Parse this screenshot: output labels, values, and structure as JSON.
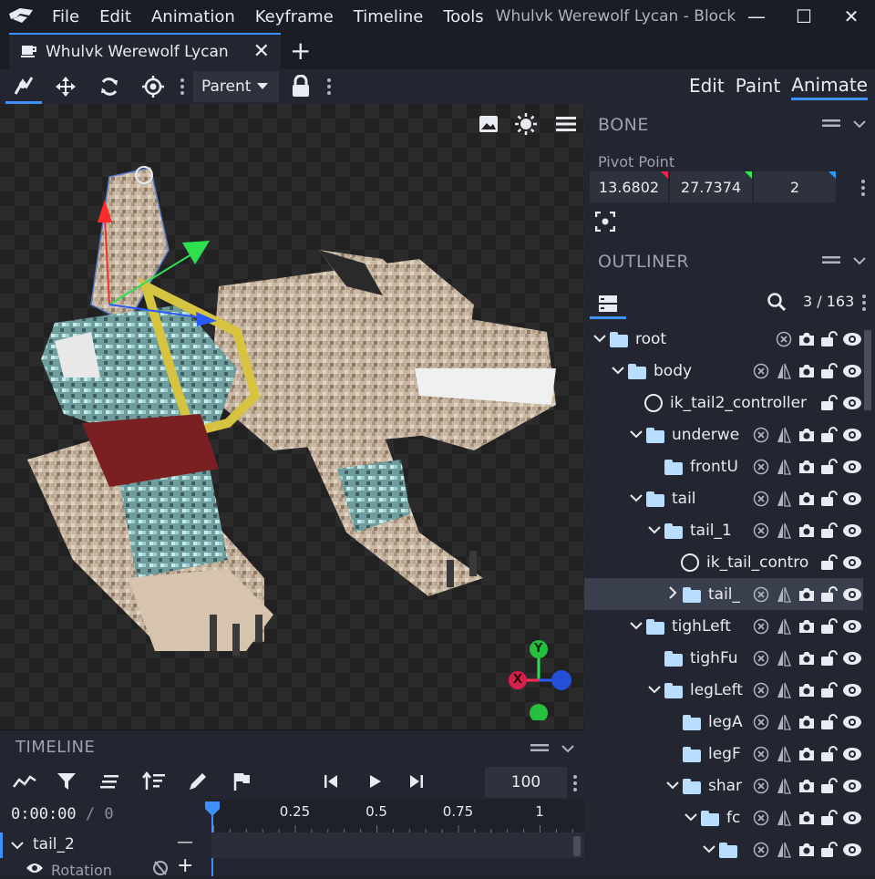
{
  "window": {
    "menu": [
      "File",
      "Edit",
      "Animation",
      "Keyframe",
      "Timeline",
      "Tools"
    ],
    "title": "Whulvk Werewolf Lycan - Block",
    "minimize": "—",
    "maximize": "☐",
    "close": "✕"
  },
  "tabs": [
    {
      "label": "Whulvk Werewolf Lycan",
      "close": "✕"
    }
  ],
  "tab_add": "+",
  "toolbar": {
    "parent_select": "Parent",
    "modes": [
      "Edit",
      "Paint",
      "Animate"
    ],
    "active_mode": "Animate"
  },
  "bone_panel": {
    "title": "BONE",
    "pivot_label": "Pivot Point",
    "pivot": [
      "13.6802",
      "27.7374",
      "2"
    ],
    "pivot_colors": [
      "#ff1f4f",
      "#2eea50",
      "#2b9bff"
    ]
  },
  "outliner": {
    "title": "OUTLINER",
    "count": "3 / 163",
    "items": [
      {
        "label": "root",
        "type": "folder",
        "depth": 0,
        "arrow": "down",
        "icons": [
          "x",
          "cam",
          "lock",
          "eye"
        ]
      },
      {
        "label": "body",
        "type": "folder",
        "depth": 1,
        "arrow": "down",
        "icons": [
          "x",
          "mirror",
          "cam",
          "lock",
          "eye"
        ]
      },
      {
        "label": "ik_tail2_controller",
        "type": "locator",
        "depth": 2,
        "arrow": "",
        "icons": [
          "lock",
          "eye"
        ]
      },
      {
        "label": "underwe",
        "type": "folder",
        "depth": 2,
        "arrow": "down",
        "icons": [
          "x",
          "mirror",
          "cam",
          "lock",
          "eye"
        ]
      },
      {
        "label": "frontU",
        "type": "folder",
        "depth": 3,
        "arrow": "",
        "icons": [
          "x",
          "mirror",
          "cam",
          "lock",
          "eye"
        ]
      },
      {
        "label": "tail",
        "type": "folder",
        "depth": 2,
        "arrow": "down",
        "icons": [
          "x",
          "mirror",
          "cam",
          "lock",
          "eye"
        ]
      },
      {
        "label": "tail_1",
        "type": "folder",
        "depth": 3,
        "arrow": "down",
        "icons": [
          "x",
          "mirror",
          "cam",
          "lock",
          "eye"
        ]
      },
      {
        "label": "ik_tail_contro",
        "type": "locator",
        "depth": 4,
        "arrow": "",
        "icons": [
          "lock",
          "eye"
        ]
      },
      {
        "label": "tail_",
        "type": "folder",
        "depth": 4,
        "arrow": "right",
        "selected": true,
        "icons": [
          "x",
          "mirror",
          "cam",
          "lock",
          "eye"
        ]
      },
      {
        "label": "tighLeft",
        "type": "folder",
        "depth": 2,
        "arrow": "down",
        "icons": [
          "x",
          "mirror",
          "cam",
          "lock",
          "eye"
        ]
      },
      {
        "label": "tighFu",
        "type": "folder",
        "depth": 3,
        "arrow": "",
        "icons": [
          "x",
          "mirror",
          "cam",
          "lock",
          "eye"
        ]
      },
      {
        "label": "legLeft",
        "type": "folder",
        "depth": 3,
        "arrow": "down",
        "icons": [
          "x",
          "mirror",
          "cam",
          "lock",
          "eye"
        ]
      },
      {
        "label": "legA",
        "type": "folder",
        "depth": 4,
        "arrow": "",
        "icons": [
          "x",
          "mirror",
          "cam",
          "lock",
          "eye"
        ]
      },
      {
        "label": "legF",
        "type": "folder",
        "depth": 4,
        "arrow": "",
        "icons": [
          "x",
          "mirror",
          "cam",
          "lock",
          "eye"
        ]
      },
      {
        "label": "shar",
        "type": "folder",
        "depth": 4,
        "arrow": "down",
        "icons": [
          "x",
          "mirror",
          "cam",
          "lock",
          "eye"
        ]
      },
      {
        "label": "fc",
        "type": "folder",
        "depth": 5,
        "arrow": "down",
        "icons": [
          "x",
          "mirror",
          "cam",
          "lock",
          "eye"
        ]
      },
      {
        "label": "",
        "type": "folder",
        "depth": 6,
        "arrow": "down",
        "icons": [
          "x",
          "mirror",
          "cam",
          "lock",
          "eye"
        ]
      }
    ]
  },
  "timeline": {
    "title": "TIMELINE",
    "fps": "100",
    "time": "0:00:00",
    "time_total": "/ 0",
    "ruler_marks": [
      "0.25",
      "0.5",
      "0.75",
      "1"
    ],
    "rows": [
      {
        "label": "tail_2",
        "action": "—"
      },
      {
        "label": "Rotation",
        "action": "+"
      }
    ]
  },
  "gizmo": {
    "y": "Y",
    "x": "X"
  }
}
